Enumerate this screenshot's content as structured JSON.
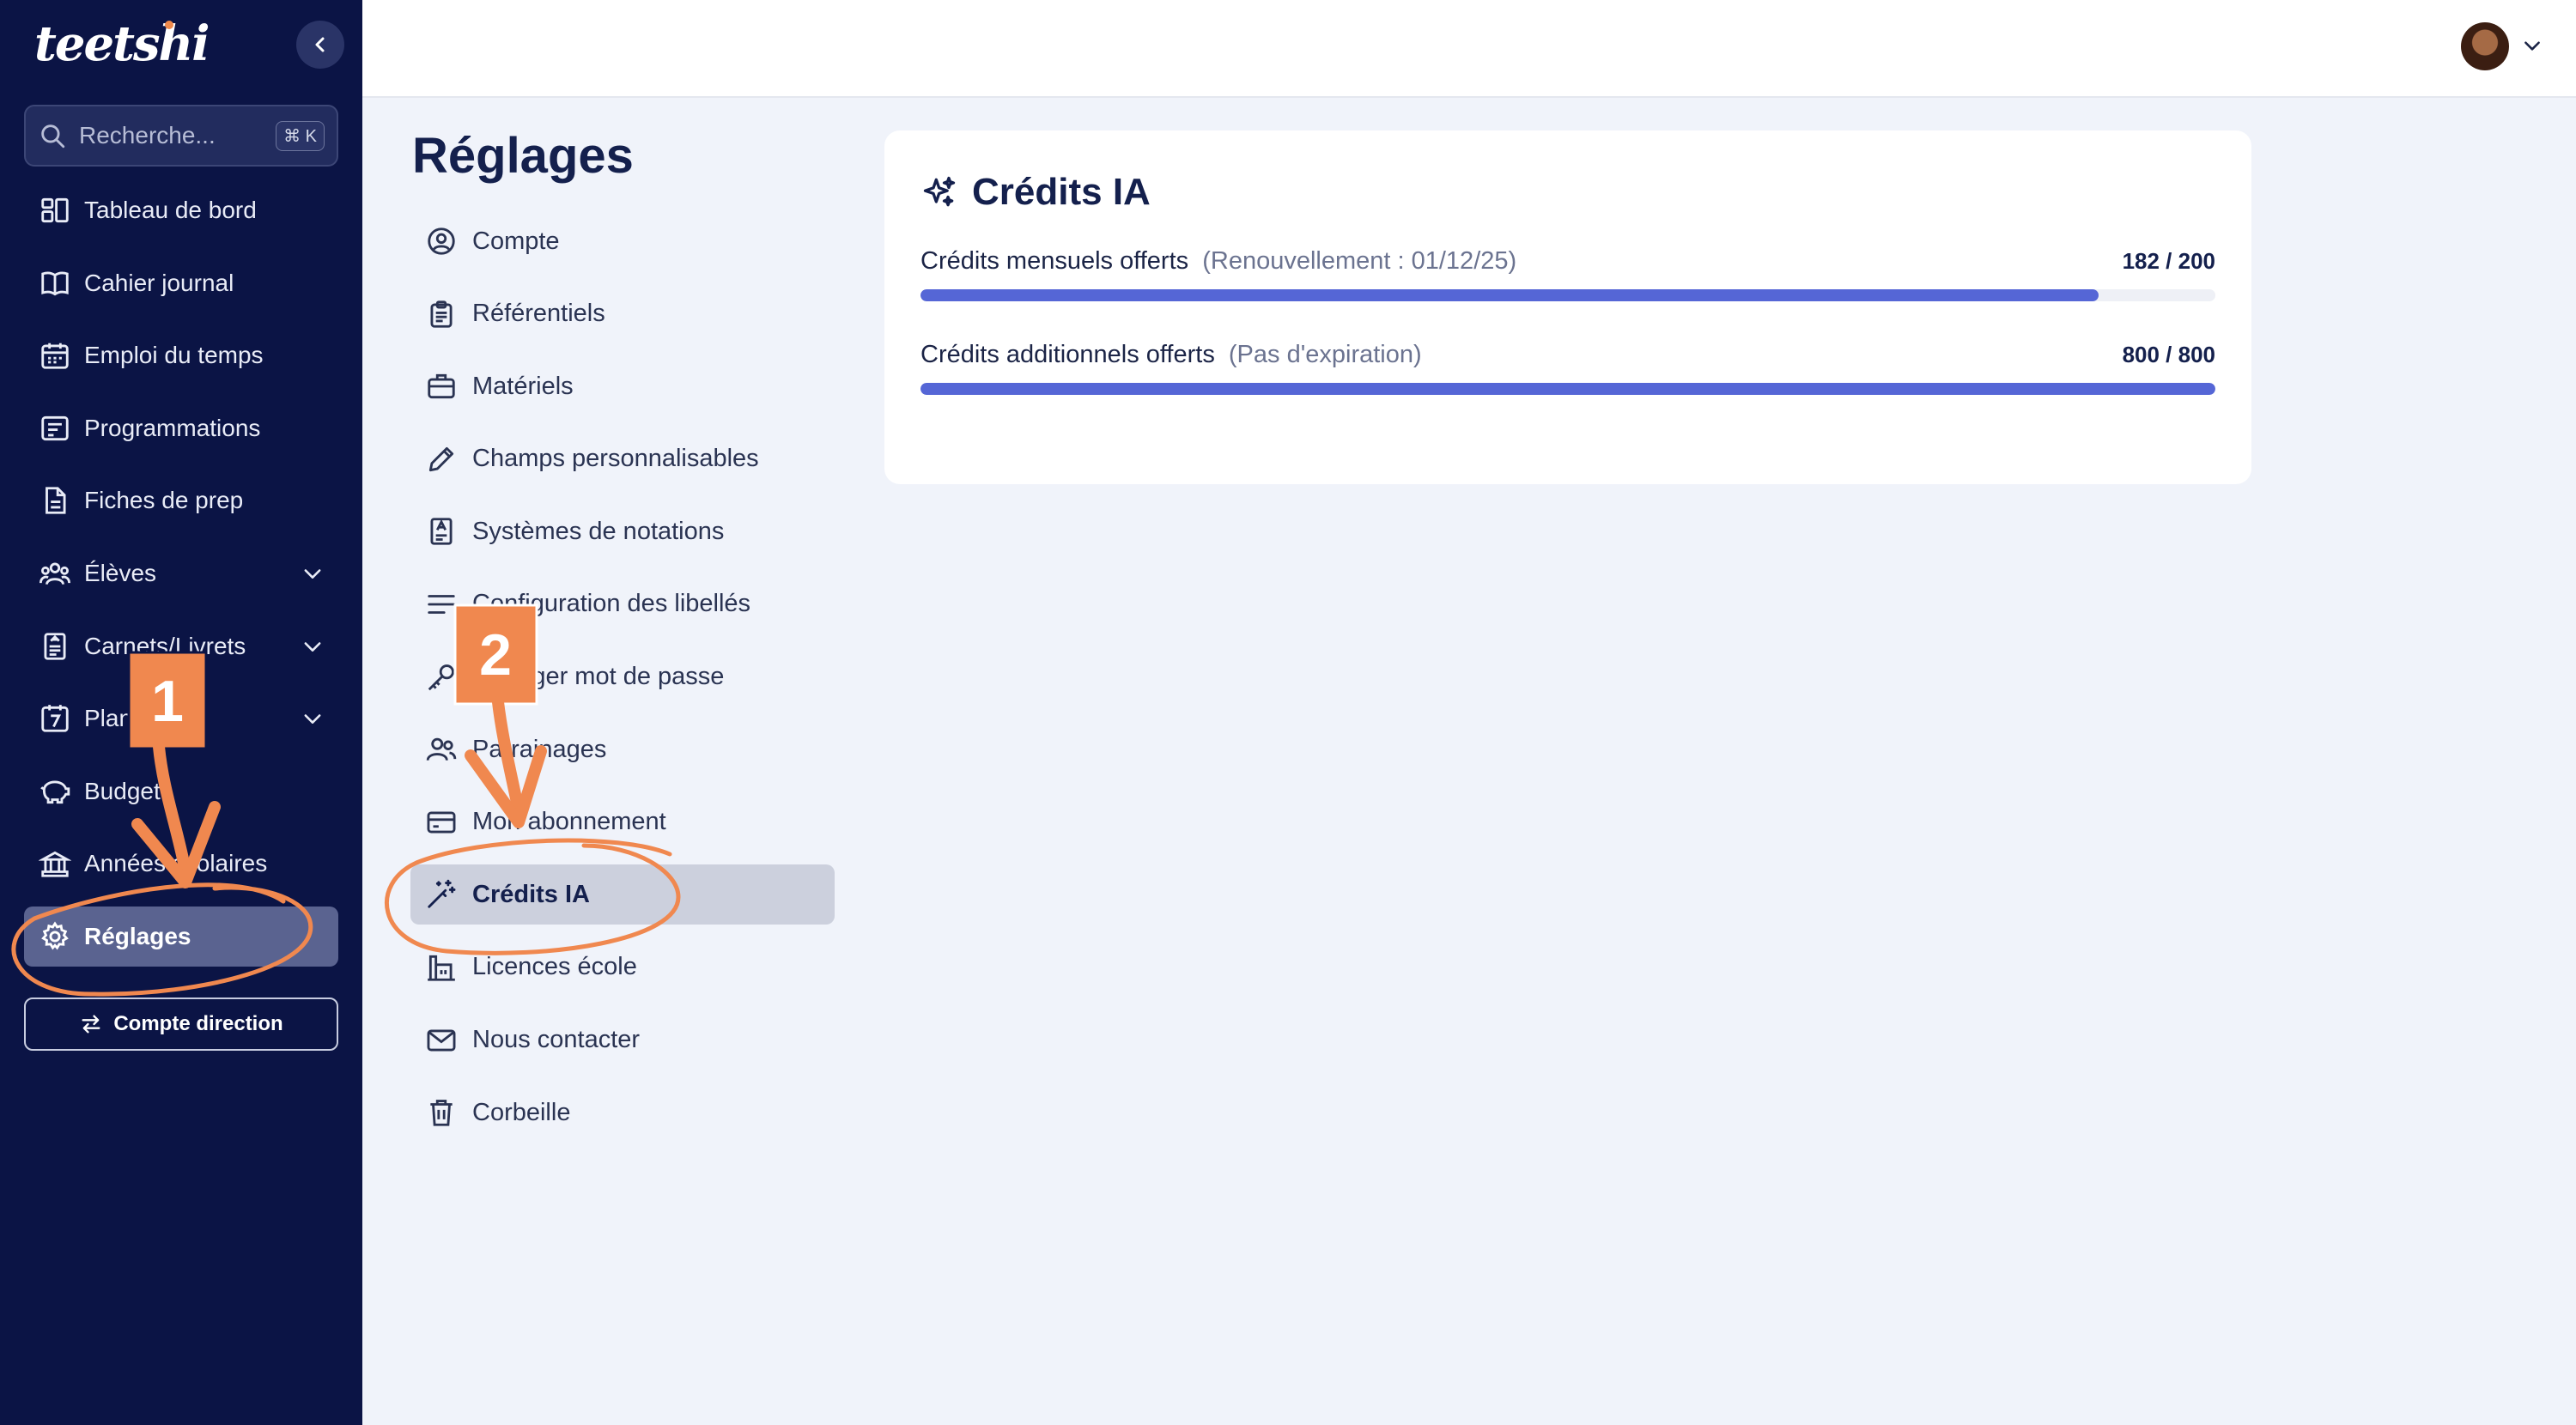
{
  "app": {
    "logo_text": "teetshi"
  },
  "sidebar": {
    "search": {
      "placeholder": "Recherche...",
      "shortcut": "⌘ K"
    },
    "items": [
      {
        "label": "Tableau de bord",
        "icon": "dashboard-icon"
      },
      {
        "label": "Cahier journal",
        "icon": "book-icon"
      },
      {
        "label": "Emploi du temps",
        "icon": "calendar-icon"
      },
      {
        "label": "Programmations",
        "icon": "list-icon"
      },
      {
        "label": "Fiches de prep",
        "icon": "file-icon"
      },
      {
        "label": "Élèves",
        "icon": "students-icon",
        "expandable": true
      },
      {
        "label": "Carnets/Livrets",
        "icon": "notebook-icon",
        "expandable": true
      },
      {
        "label": "Planning",
        "icon": "planning-icon",
        "expandable": true
      },
      {
        "label": "Budget",
        "icon": "piggy-bank-icon"
      },
      {
        "label": "Années scolaires",
        "icon": "school-icon"
      },
      {
        "label": "Réglages",
        "icon": "gear-icon",
        "active": true
      }
    ],
    "direction_button": "Compte direction"
  },
  "settings": {
    "title": "Réglages",
    "menu": [
      {
        "label": "Compte",
        "icon": "user-circle-icon"
      },
      {
        "label": "Référentiels",
        "icon": "clipboard-icon"
      },
      {
        "label": "Matériels",
        "icon": "briefcase-icon"
      },
      {
        "label": "Champs personnalisables",
        "icon": "pencil-icon"
      },
      {
        "label": "Systèmes de notations",
        "icon": "grade-icon"
      },
      {
        "label": "Configuration des libellés",
        "icon": "lines-icon"
      },
      {
        "label": "Changer mot de passe",
        "icon": "key-icon"
      },
      {
        "label": "Parrainages",
        "icon": "users-icon"
      },
      {
        "label": "Mon abonnement",
        "icon": "credit-card-icon"
      },
      {
        "label": "Crédits IA",
        "icon": "magic-wand-icon",
        "active": true
      },
      {
        "label": "Licences école",
        "icon": "building-icon"
      },
      {
        "label": "Nous contacter",
        "icon": "mail-icon"
      },
      {
        "label": "Corbeille",
        "icon": "trash-icon"
      }
    ]
  },
  "credits_card": {
    "title": "Crédits IA",
    "monthly": {
      "label": "Crédits mensuels offerts",
      "note": "(Renouvellement : 01/12/25)",
      "used": 182,
      "total": 200,
      "display": "182 / 200"
    },
    "additional": {
      "label": "Crédits additionnels offerts",
      "note": "(Pas d'expiration)",
      "used": 800,
      "total": 800,
      "display": "800 / 800"
    }
  },
  "annotations": {
    "step1": "1",
    "step2": "2"
  },
  "colors": {
    "sidebar_bg": "#0b1445",
    "accent": "#5566d6",
    "annotation": "#f0884f",
    "page_bg": "#f0f3fa"
  }
}
